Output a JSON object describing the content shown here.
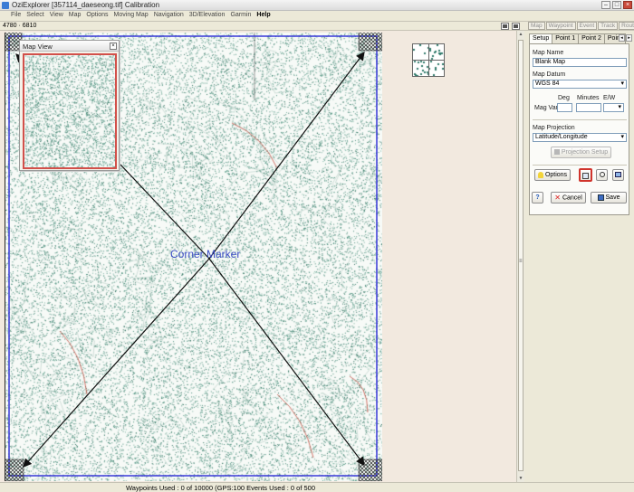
{
  "window": {
    "title": "OziExplorer [357114_daeseong.tif] Calibration"
  },
  "menu": [
    "File",
    "Select",
    "View",
    "Map",
    "Options",
    "Moving Map",
    "Navigation",
    "3D/Elevation",
    "Garmin",
    "Help"
  ],
  "toolbar": {
    "coords": "4780 · 6810",
    "mode_tabs": [
      "Map",
      "Waypoint",
      "Event",
      "Track",
      "Route"
    ]
  },
  "map": {
    "corner_label": "Corner Marker",
    "map_view_title": "Map View"
  },
  "panel": {
    "tabs": [
      "Setup",
      "Point 1",
      "Point 2",
      "Point"
    ],
    "map_name_label": "Map Name",
    "map_name_value": "Blank Map",
    "map_datum_label": "Map Datum",
    "map_datum_value": "WGS 84",
    "deg_label": "Deg",
    "minutes_label": "Minutes",
    "ew_label": "E/W",
    "mag_var_label": "Mag Var",
    "projection_label": "Map Projection",
    "projection_value": "Latitude/Longitude",
    "projection_setup_label": "Projection Setup",
    "options_label": "Options",
    "help_label": "?",
    "cancel_label": "Cancel",
    "save_label": "Save"
  },
  "status": {
    "text": "Waypoints Used : 0 of 10000  (GPS:100  Events Used : 0 of 500"
  },
  "colors": {
    "map_border": "#2b2bd6",
    "arrow": "#111111",
    "corner_label": "#3a4cc4",
    "map_dots": "#4a8f7c",
    "road": "#c0392b"
  }
}
